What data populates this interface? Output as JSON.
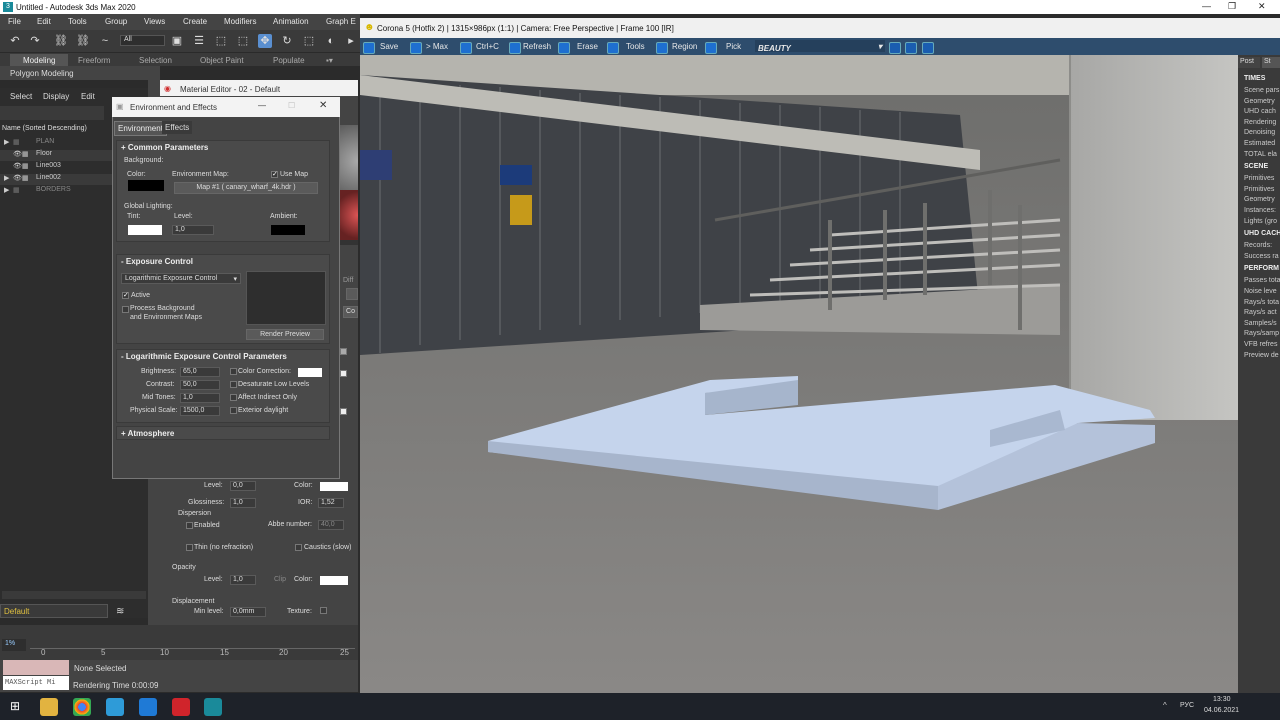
{
  "max_window": {
    "title": "Untitled - Autodesk 3ds Max 2020",
    "menu": [
      "File",
      "Edit",
      "Tools",
      "Group",
      "Views",
      "Create",
      "Modifiers",
      "Animation",
      "Graph E"
    ],
    "selection_filter": "All",
    "ribbon_tabs": [
      "Modeling",
      "Freeform",
      "Selection",
      "Object Paint",
      "Populate"
    ],
    "ribbon_sub": "Polygon Modeling"
  },
  "scene_explorer": {
    "menu": [
      "Select",
      "Display",
      "Edit"
    ],
    "header": "Name (Sorted Descending)",
    "items": [
      "PLAN",
      "Floor",
      "Line003",
      "Line002",
      "BORDERS"
    ],
    "layer": "Default"
  },
  "material_editor": {
    "title": "Material Editor - 02 - Default",
    "level_label": "Level:",
    "level": "0,0",
    "color_label": "Color:",
    "glossiness_label": "Glossiness:",
    "glossiness": "1,0",
    "ior_label": "IOR:",
    "ior": "1,52",
    "dispersion": "Dispersion",
    "enabled": "Enabled",
    "abbe_label": "Abbe number:",
    "abbe": "40,0",
    "thin": "Thin (no refraction)",
    "caustics": "Caustics (slow)",
    "opacity": "Opacity",
    "op_level": "1,0",
    "clip": "Clip",
    "displacement": "Displacement",
    "min_level_label": "Min level:",
    "min_level": "0,0mm",
    "texture": "Texture:",
    "diffuse_short": "Diff",
    "co_short": "Co"
  },
  "env_dialog": {
    "title": "Environment and Effects",
    "tabs": [
      "Environment",
      "Effects"
    ],
    "common": "Common Parameters",
    "background": "Background:",
    "color": "Color:",
    "env_map": "Environment Map:",
    "use_map": "Use Map",
    "map_name": "Map #1 ( canary_wharf_4k.hdr )",
    "global_lighting": "Global Lighting:",
    "tint": "Tint:",
    "level": "Level:",
    "level_val": "1,0",
    "ambient": "Ambient:",
    "exposure": "Exposure Control",
    "exposure_type": "Logarithmic Exposure Control",
    "active": "Active",
    "process_bg": "Process Background",
    "process_bg2": "and Environment Maps",
    "render_preview": "Render Preview",
    "log_params": "Logarithmic Exposure Control Parameters",
    "brightness_label": "Brightness:",
    "brightness": "65,0",
    "contrast_label": "Contrast:",
    "contrast": "50,0",
    "midtones_label": "Mid Tones:",
    "midtones": "1,0",
    "physical_label": "Physical Scale:",
    "physical": "1500,0",
    "color_correction": "Color Correction:",
    "desaturate": "Desaturate Low Levels",
    "affect_indirect": "Affect Indirect Only",
    "exterior": "Exterior daylight",
    "atmosphere": "Atmosphere"
  },
  "vfb": {
    "title": "Corona 5 (Hotfix 2) | 1315×986px (1:1) | Camera: Free Perspective | Frame 100 [IR]",
    "tools": [
      "Save",
      "> Max",
      "Ctrl+C",
      "Refresh",
      "Erase",
      "Tools",
      "Region",
      "Pick"
    ],
    "channel": "BEAUTY",
    "side_tabs": [
      "Post",
      "St"
    ],
    "stats": [
      {
        "h": "TIMES"
      },
      {
        "t": "Scene pars"
      },
      {
        "t": "Geometry"
      },
      {
        "t": "UHD cach"
      },
      {
        "t": "Rendering"
      },
      {
        "t": "Denoising"
      },
      {
        "t": "Estimated"
      },
      {
        "t": "TOTAL ela"
      },
      {
        "h": "SCENE"
      },
      {
        "t": "Primitives"
      },
      {
        "t": "Primitives"
      },
      {
        "t": "Geometry"
      },
      {
        "t": "Instances:"
      },
      {
        "t": "Lights (gro"
      },
      {
        "h": "UHD CACH"
      },
      {
        "t": "Records:"
      },
      {
        "t": "Success ra"
      },
      {
        "h": "PERFORM"
      },
      {
        "t": "Passes tota"
      },
      {
        "t": "Noise leve"
      },
      {
        "t": "Rays/s tota"
      },
      {
        "t": "Rays/s act"
      },
      {
        "t": "Samples/s"
      },
      {
        "t": "Rays/samp"
      },
      {
        "t": "VFB refres"
      },
      {
        "t": "Preview de"
      }
    ]
  },
  "timeline": {
    "ticks": [
      "0",
      "5",
      "10",
      "15",
      "20",
      "25"
    ],
    "frame": "1%"
  },
  "status": {
    "selected": "None Selected",
    "render_time": "Rendering Time  0:00:09",
    "maxscript": "MAXScript Mi"
  },
  "taskbar": {
    "lang": "РУС",
    "time": "13:30",
    "date": "04.06.2021"
  }
}
